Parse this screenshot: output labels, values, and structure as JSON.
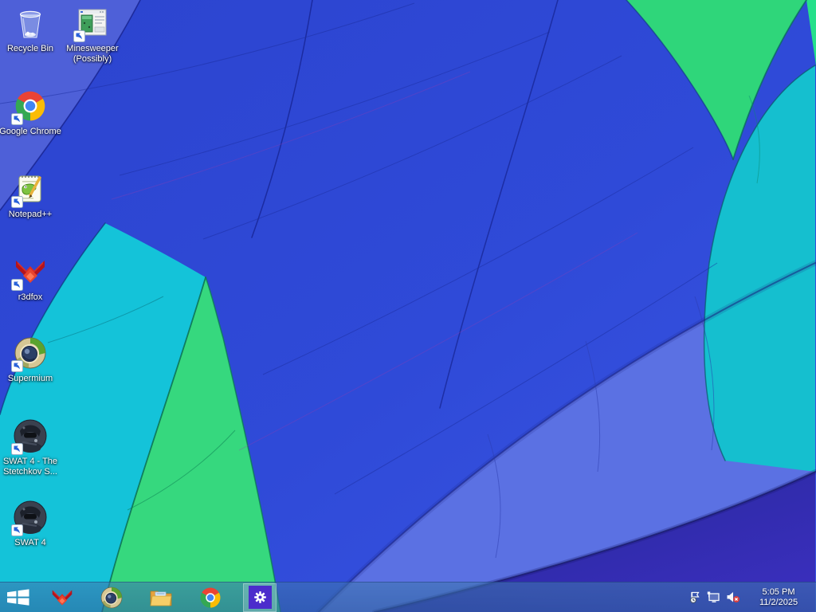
{
  "wallpaper": {
    "description": "Windows 8.1 default wallpaper - close-up of multicolored hot air balloon fabric gores",
    "palette": {
      "royal_blue": "#2d47d3",
      "periwinkle": "#4e60d8",
      "light_blue_band": "#5b71e3",
      "cyan_band": "#14c3d9",
      "green_band": "#36d87e",
      "teal_band": "#15bfcf",
      "navy_corner": "#2d2fb4"
    }
  },
  "desktop": {
    "icons": [
      {
        "name": "recycle-bin",
        "label": "Recycle Bin",
        "shortcut": false
      },
      {
        "name": "minesweeper",
        "label": "Minesweeper (Possibly)",
        "shortcut": true
      },
      {
        "name": "google-chrome",
        "label": "Google Chrome",
        "shortcut": true
      },
      {
        "name": "notepad-plus-plus",
        "label": "Notepad++",
        "shortcut": true
      },
      {
        "name": "r3dfox",
        "label": "r3dfox",
        "shortcut": true
      },
      {
        "name": "supermium",
        "label": "Supermium",
        "shortcut": true
      },
      {
        "name": "swat4-stetchkov",
        "label": "SWAT 4 - The Stetchkov S...",
        "shortcut": true
      },
      {
        "name": "swat4",
        "label": "SWAT 4",
        "shortcut": true
      }
    ]
  },
  "taskbar": {
    "start_button": {
      "name": "start"
    },
    "pinned": [
      {
        "name": "r3dfox",
        "active": false
      },
      {
        "name": "supermium",
        "active": false
      },
      {
        "name": "file-explorer",
        "active": false
      },
      {
        "name": "google-chrome",
        "active": false
      },
      {
        "name": "pc-settings",
        "active": true
      }
    ],
    "tray": {
      "icons": [
        "action-center",
        "network",
        "volume-muted"
      ],
      "clock": {
        "time": "5:05 PM",
        "date": "11/2/2025"
      }
    }
  }
}
